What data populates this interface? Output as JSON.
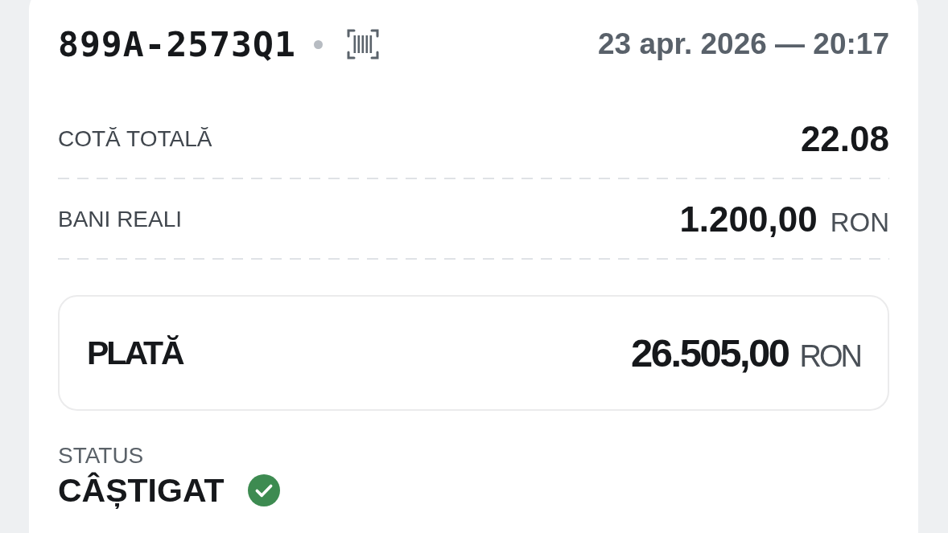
{
  "ticket": {
    "code": "899A-2573Q1",
    "date": "23 apr. 2026 — 20:17"
  },
  "details": [
    {
      "label": "COTĂ TOTALĂ",
      "value": "22.08"
    },
    {
      "label": "BANI REALI",
      "value": "1.200,00",
      "currency": "RON"
    }
  ],
  "payout": {
    "label": "PLATĂ",
    "value": "26.505,00",
    "currency": "RON"
  },
  "status": {
    "label": "STATUS",
    "value": "CÂȘTIGAT",
    "won": true
  }
}
